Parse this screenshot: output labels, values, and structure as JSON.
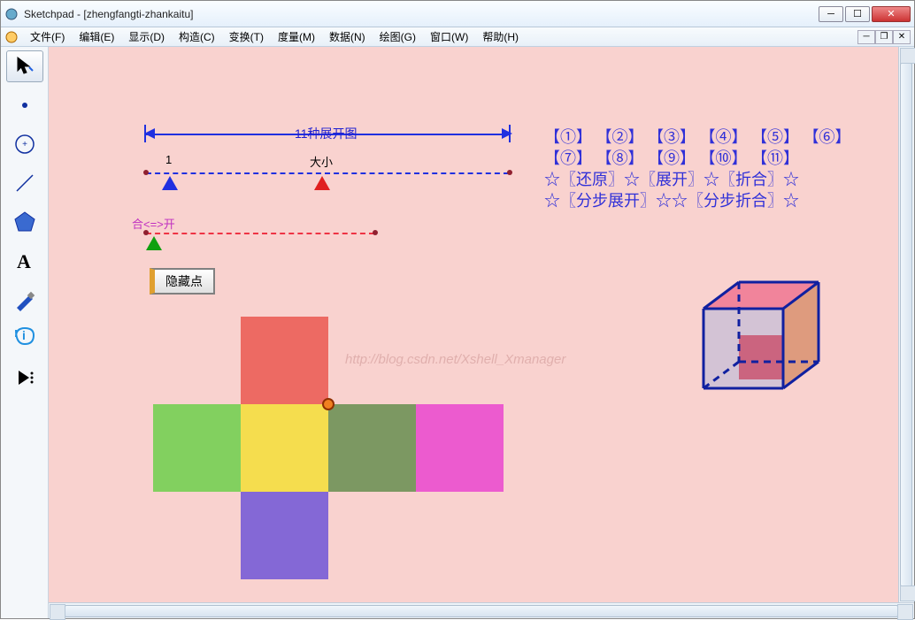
{
  "window": {
    "title": "Sketchpad  - [zhengfangti-zhankaitu]"
  },
  "menu": {
    "file": "文件(F)",
    "edit": "编辑(E)",
    "display": "显示(D)",
    "construct": "构造(C)",
    "transform": "变换(T)",
    "measure": "度量(M)",
    "data": "数据(N)",
    "plot": "绘图(G)",
    "window": "窗口(W)",
    "help": "帮助(H)"
  },
  "ruler": {
    "title": "11种展开图",
    "label_left": "1",
    "label_mid": "大小"
  },
  "slider2": {
    "label": "合<=>开"
  },
  "buttons": {
    "hide_point": "隐藏点"
  },
  "links": {
    "row1": [
      "【①】",
      "【②】",
      "【③】",
      "【④】",
      "【⑤】",
      "【⑥】"
    ],
    "row2": [
      "【⑦】",
      "【⑧】",
      "【⑨】",
      "【⑩】",
      "【⑪】"
    ],
    "row3": [
      "☆",
      "〖还原〗",
      "☆",
      "〖展开〗",
      "☆",
      "〖折合〗",
      "☆"
    ],
    "row4": [
      "☆",
      "〖分步展开〗",
      "☆☆",
      "〖分步折合〗",
      "☆"
    ]
  },
  "watermark": "http://blog.csdn.net/Xshell_Xmanager",
  "net_colors": {
    "top": "#ed6a63",
    "left": "#82d05f",
    "mid": "#f5dd4e",
    "mid2": "#7c9862",
    "right": "#ec5bcf",
    "bottom": "#8468d6"
  },
  "cube_colors": {
    "edge": "#1020a0",
    "front": "rgba(100,150,230,0.35)",
    "right": "rgba(200,110,60,0.55)",
    "top_face": "rgba(235,80,120,0.55)",
    "inner": "rgba(200,60,90,0.7)"
  }
}
